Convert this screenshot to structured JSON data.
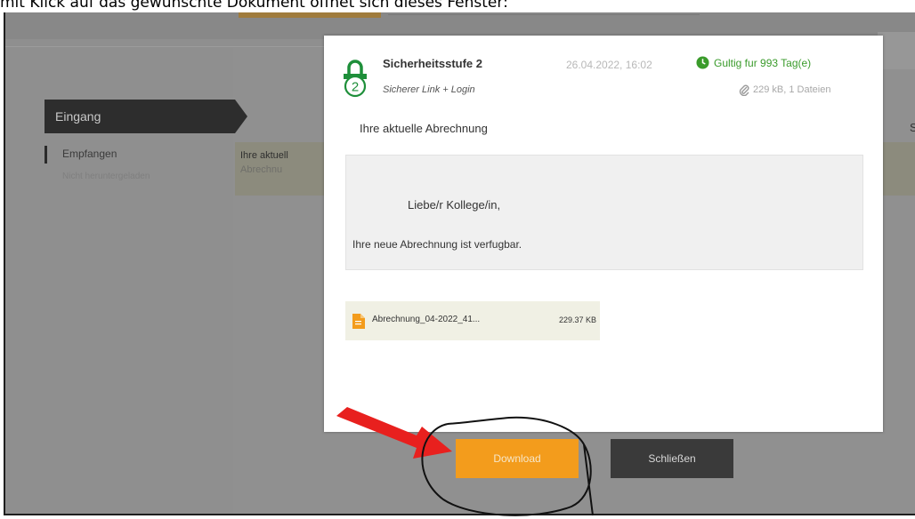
{
  "caption": "mit Klick auf das gewünschte Dokument öffnet sich dieses Fenster:",
  "background": {
    "tab_label": "Eingang",
    "sidebar_items": [
      "Empfangen",
      "Nicht heruntergeladen"
    ],
    "message_line1": "Ihre aktuell",
    "message_line2": "Abrechnu",
    "right_letter": "S"
  },
  "modal": {
    "security_level_number": "2",
    "security_title": "Sicherheitsstufe 2",
    "security_subtitle": "Sicherer Link + Login",
    "date": "26.04.2022, 16:02",
    "validity": "Gultig fur 993 Tag(e)",
    "size_info": "229 kB, 1 Dateien",
    "subject": "Ihre aktuelle Abrechnung",
    "greeting": "Liebe/r Kollege/in,",
    "body_text": "Ihre neue Abrechnung ist verfugbar.",
    "attachment": {
      "name": "Abrechnung_04-2022_41...",
      "size": "229.37 KB"
    }
  },
  "buttons": {
    "download": "Download",
    "close": "Schließen"
  },
  "colors": {
    "accent_orange": "#f39c1c",
    "valid_green": "#3a9b2b",
    "annotation_red": "#e8201e"
  },
  "icons": [
    "lock-icon",
    "clock-icon",
    "paperclip-icon",
    "file-icon",
    "red-arrow-annotation",
    "hand-drawn-circle-annotation"
  ]
}
